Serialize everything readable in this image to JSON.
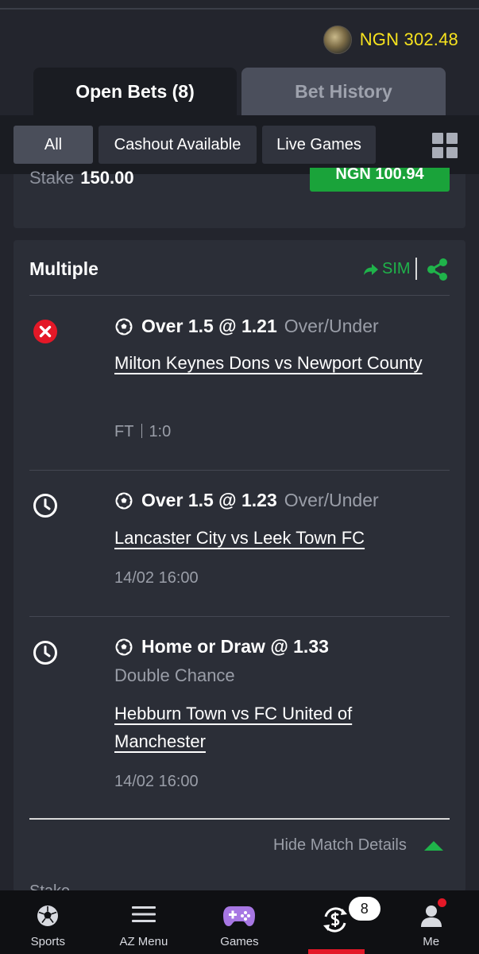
{
  "header": {
    "balance": "NGN 302.48"
  },
  "tabs": [
    {
      "label": "Open Bets (8)",
      "active": true
    },
    {
      "label": "Bet History",
      "active": false
    }
  ],
  "filters": [
    {
      "label": "All",
      "selected": true
    },
    {
      "label": "Cashout Available",
      "selected": false
    },
    {
      "label": "Live Games",
      "selected": false
    }
  ],
  "previous_bet": {
    "stake_label": "Stake",
    "stake_value": "150.00",
    "cashout_label": "NGN 100.94"
  },
  "bet": {
    "title": "Multiple",
    "sim_label": "SIM",
    "legs": [
      {
        "status": "lost",
        "selection": "Over 1.5 @ 1.21",
        "market": "Over/Under",
        "match": "Milton Keynes Dons vs Newport County",
        "time": "FT",
        "score": "1:0"
      },
      {
        "status": "pending",
        "selection": "Over 1.5 @ 1.23",
        "market": "Over/Under",
        "match": "Lancaster City vs Leek Town FC",
        "time": "14/02 16:00"
      },
      {
        "status": "pending",
        "selection": "Home or Draw @ 1.33",
        "market": "Double Chance",
        "match": "Hebburn Town vs FC United of Manchester",
        "time": "14/02 16:00"
      }
    ],
    "hide_details_label": "Hide Match Details",
    "stake_label": "Stake"
  },
  "nav": [
    {
      "label": "Sports",
      "icon": "football-icon"
    },
    {
      "label": "AZ Menu",
      "icon": "menu-icon"
    },
    {
      "label": "Games",
      "icon": "gamepad-icon"
    },
    {
      "label": "",
      "icon": "cashout-icon",
      "badge": "8"
    },
    {
      "label": "Me",
      "icon": "user-icon"
    }
  ],
  "colors": {
    "accent_green": "#1fb34a",
    "balance_yellow": "#f6e21e",
    "lost_red": "#e41827",
    "nav_active": "#e41827"
  }
}
